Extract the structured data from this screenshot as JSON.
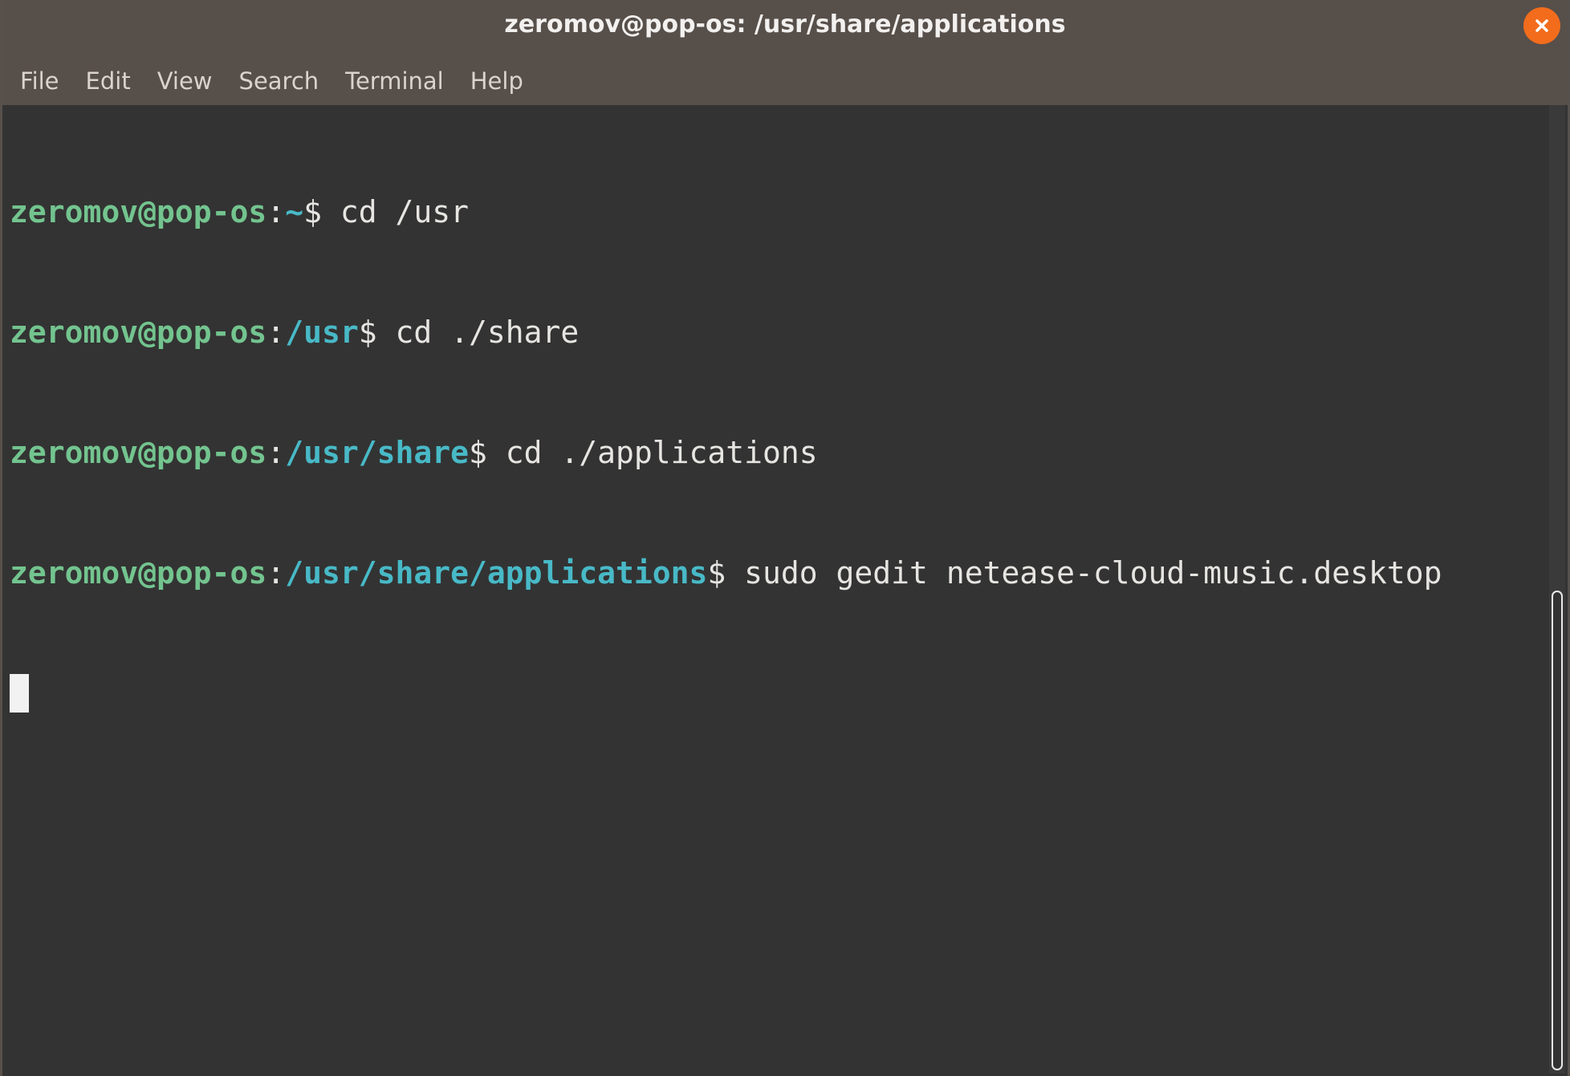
{
  "window": {
    "title": "zeromov@pop-os: /usr/share/applications"
  },
  "menu": {
    "items": [
      "File",
      "Edit",
      "View",
      "Search",
      "Terminal",
      "Help"
    ]
  },
  "terminal": {
    "lines": [
      {
        "user": "zeromov@pop-os",
        "sep": ":",
        "path": "~",
        "prompt": "$ ",
        "command": "cd /usr"
      },
      {
        "user": "zeromov@pop-os",
        "sep": ":",
        "path": "/usr",
        "prompt": "$ ",
        "command": "cd ./share"
      },
      {
        "user": "zeromov@pop-os",
        "sep": ":",
        "path": "/usr/share",
        "prompt": "$ ",
        "command": "cd ./applications"
      },
      {
        "user": "zeromov@pop-os",
        "sep": ":",
        "path": "/usr/share/applications",
        "prompt": "$ ",
        "command": "sudo gedit netease-cloud-music.desktop"
      }
    ]
  },
  "colors": {
    "titlebar": "#574f4a",
    "close": "#f26c1c",
    "background": "#333333",
    "user": "#73c48f",
    "path": "#48b9c7",
    "text": "#e7e5e2"
  },
  "icons": {
    "close": "close-icon",
    "cursor": "text-cursor"
  }
}
